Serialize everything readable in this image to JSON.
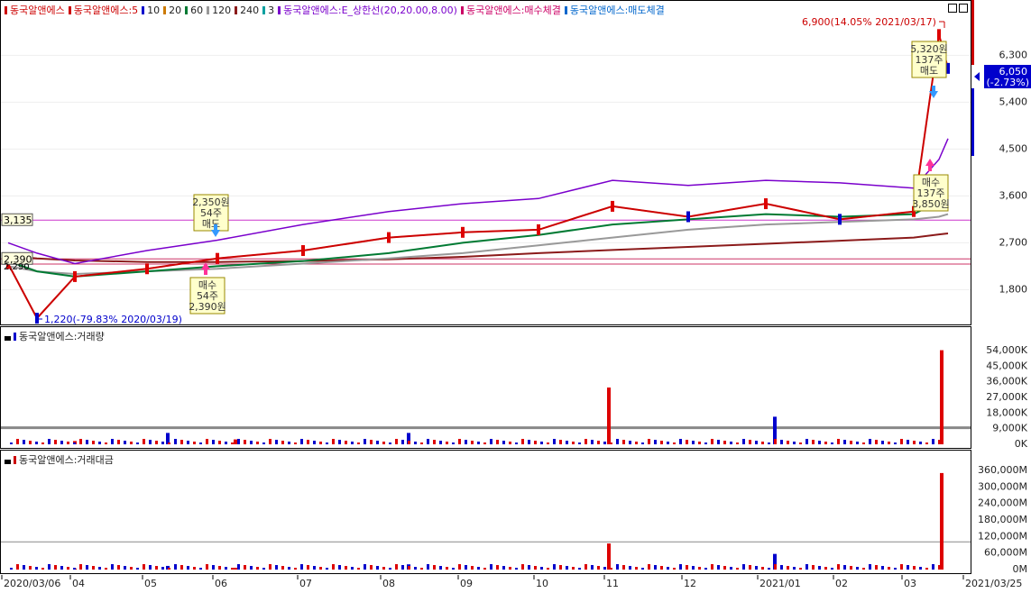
{
  "legend_price": [
    {
      "label": "동국알앤에스",
      "color": "#cc0000"
    },
    {
      "label": "동국알앤에스:5",
      "color": "#cc0000"
    },
    {
      "label": "10",
      "color": "#0000cc"
    },
    {
      "label": "20",
      "color": "#cc7a00"
    },
    {
      "label": "60",
      "color": "#007a33"
    },
    {
      "label": "120",
      "color": "#999999"
    },
    {
      "label": "240",
      "color": "#8b1a1a"
    },
    {
      "label": "3",
      "color": "#00a0a0"
    },
    {
      "label": "동국알앤에스:E_상한선(20,20.00,8.00)",
      "color": "#7a00cc"
    },
    {
      "label": "동국알앤에스:매수체결",
      "color": "#cc0066"
    },
    {
      "label": "동국알앤에스:매도체결",
      "color": "#0066cc"
    }
  ],
  "legend_volume": "동국알앤에스:거래량",
  "legend_amount": "동국알앤에스:거래대금",
  "price_axis": [
    "6,300",
    "5,400",
    "4,500",
    "3,600",
    "2,700",
    "1,800"
  ],
  "volume_axis": [
    "54,000K",
    "45,000K",
    "36,000K",
    "27,000K",
    "18,000K",
    "9,000K",
    "0K"
  ],
  "amount_axis": [
    "360,000M",
    "300,000M",
    "240,000M",
    "180,000M",
    "120,000M",
    "60,000M",
    "0M"
  ],
  "x_axis": [
    "2020/03/06",
    "04",
    "05",
    "06",
    "07",
    "08",
    "09",
    "10",
    "11",
    "12",
    "2021/01",
    "02",
    "03",
    "2021/03/25"
  ],
  "annotations": {
    "high": "6,900(14.05% 2021/03/17)",
    "low": "1,220(-79.83% 2020/03/19)",
    "current_price": "6,050",
    "current_change": "(-2.73%)",
    "left_level_1": "3,135",
    "left_level_2": "2,390",
    "left_level_3": "2,290",
    "sell1": [
      "2,350원",
      "54주",
      "매도"
    ],
    "buy1": [
      "매수",
      "54주",
      "2,390원"
    ],
    "sell2": [
      "5,320원",
      "137주",
      "매도"
    ],
    "buy2": [
      "매수",
      "137주",
      "3,850원"
    ]
  },
  "chart_data": [
    {
      "type": "line",
      "title": "동국알앤에스",
      "x": [
        "2020/03/06",
        "2020/03/19",
        "2020/04",
        "2020/05",
        "2020/06",
        "2020/07",
        "2020/08",
        "2020/09",
        "2020/10",
        "2020/11",
        "2020/12",
        "2021/01",
        "2021/02",
        "2021/03",
        "2021/03/17",
        "2021/03/25"
      ],
      "series": [
        {
          "name": "동국알앤에스",
          "values": [
            2300,
            1250,
            2050,
            2200,
            2400,
            2550,
            2800,
            2900,
            2950,
            3400,
            3200,
            3450,
            3150,
            3300,
            6700,
            6050
          ]
        }
      ],
      "ylim": [
        1200,
        7000
      ]
    },
    {
      "type": "bar",
      "title": "동국알앤에스:거래량",
      "categories": [
        "2020/04",
        "2020/05",
        "2020/06",
        "2020/08",
        "2020/11",
        "2021/01",
        "2021/03"
      ],
      "values": [
        2000,
        7000,
        3000,
        7000,
        35000,
        17000,
        58000
      ],
      "ylim": [
        0,
        60000
      ]
    },
    {
      "type": "bar",
      "title": "동국알앤에스:거래대금",
      "categories": [
        "2020/04",
        "2020/05",
        "2020/06",
        "2020/08",
        "2020/11",
        "2021/01",
        "2021/03"
      ],
      "values": [
        4000,
        14000,
        7000,
        20000,
        100000,
        60000,
        370000
      ],
      "ylim": [
        0,
        380000
      ]
    }
  ]
}
